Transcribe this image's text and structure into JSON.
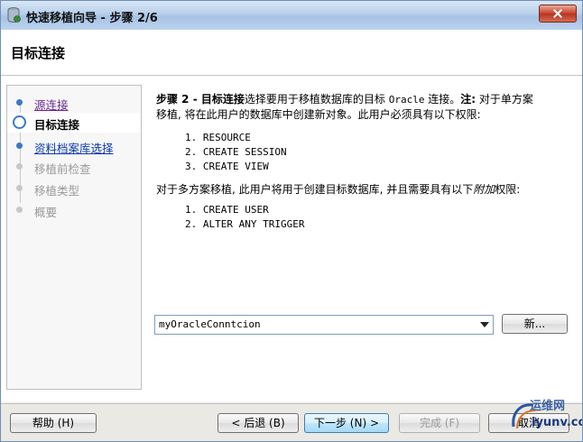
{
  "window": {
    "title": "快速移植向导 - 步骤 2/6",
    "header": "目标连接"
  },
  "nav": {
    "items": [
      {
        "label": "源连接",
        "state": "visited"
      },
      {
        "label": "目标连接",
        "state": "current"
      },
      {
        "label": "资料档案库选择",
        "state": "link"
      },
      {
        "label": "移植前检查",
        "state": "disabled"
      },
      {
        "label": "移植类型",
        "state": "disabled"
      },
      {
        "label": "概要",
        "state": "disabled"
      }
    ]
  },
  "content": {
    "step_prefix": "步骤 2 - 目标连接",
    "intro_line1_part1": "选择要用于移植数据库的目标 ",
    "intro_oracle": "Oracle",
    "intro_line1_part2": " 连接。",
    "note_label": "注:",
    "intro_line1_part3": " 对于单方案",
    "intro_line2": "移植, 将在此用户的数据库中创建新对象。此用户必须具有以下权限:",
    "single_privs": [
      "1. RESOURCE",
      "2. CREATE SESSION",
      "3. CREATE VIEW"
    ],
    "multi_part1": "对于多方案移植, 此用户将用于创建目标数据库, 并且需要具有以下",
    "multi_italic": "附加",
    "multi_part2": "权限:",
    "multi_privs": [
      "1. CREATE USER",
      "2. ALTER ANY TRIGGER"
    ]
  },
  "connection": {
    "selected": "myOracleConntcion",
    "new_button": "新..."
  },
  "footer": {
    "help": "帮助 (H)",
    "back": "< 后退 (B)",
    "next": "下一步 (N) >",
    "finish": "完成 (F)",
    "cancel": "取消"
  },
  "watermark": {
    "line1": "运维网",
    "line2": "iyunv.com"
  }
}
